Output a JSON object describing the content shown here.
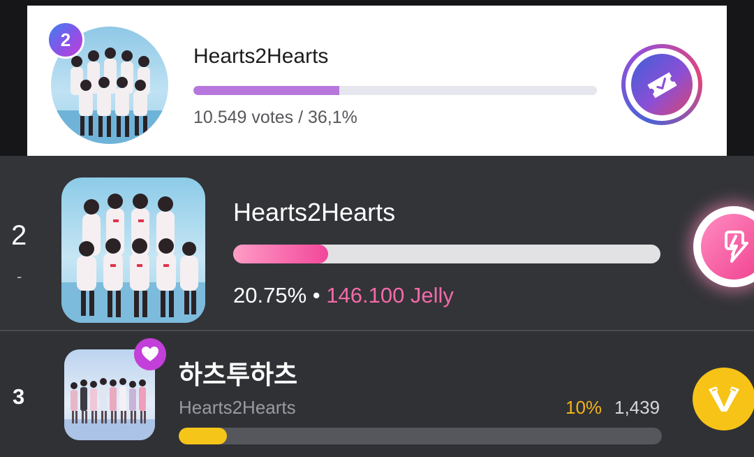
{
  "panel1": {
    "rank": "2",
    "artist": "Hearts2Hearts",
    "progress_pct": 36.1,
    "stats": "10.549 votes / 36,1%",
    "vote_icon": "vote-ticket-icon",
    "colors": {
      "bar": "#b877dc",
      "rank_badge": "#8a52e8"
    }
  },
  "panel2": {
    "rank": "2",
    "rank_change": "-",
    "artist": "Hearts2Hearts",
    "progress_pct": 20.75,
    "percent": "20.75%",
    "separator": "•",
    "jelly": "146.100 Jelly",
    "action_icon": "lightning-bolt-icon",
    "colors": {
      "bar": "#f2479a",
      "jelly": "#f26aa8"
    }
  },
  "panel3": {
    "rank": "3",
    "artist_korean": "하츠투하츠",
    "artist": "Hearts2Hearts",
    "percent": "10%",
    "count": "1,439",
    "progress_pct": 10,
    "badge_icon": "heart-icon",
    "action_icon": "v-logo-icon",
    "colors": {
      "bar": "#f5c51a",
      "percent": "#f2b417",
      "heart_badge": "#c33fd9"
    }
  }
}
